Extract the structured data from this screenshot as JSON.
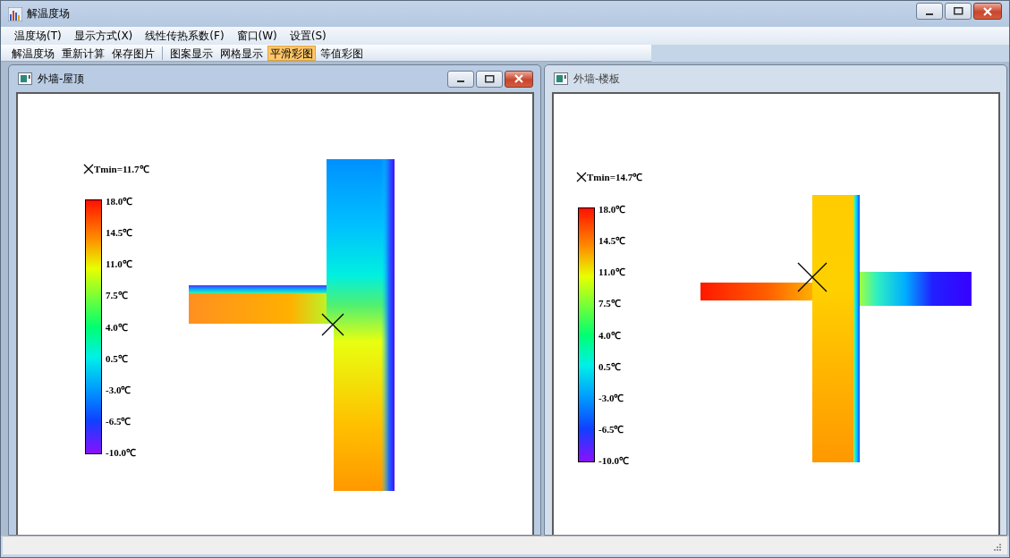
{
  "window": {
    "title": "解温度场"
  },
  "menu": [
    {
      "label": "温度场(T)"
    },
    {
      "label": "显示方式(X)"
    },
    {
      "label": "线性传热系数(F)"
    },
    {
      "label": "窗口(W)"
    },
    {
      "label": "设置(S)"
    }
  ],
  "toolbar": [
    {
      "label": "解温度场",
      "selected": false,
      "separator_before": false
    },
    {
      "label": "重新计算",
      "selected": false,
      "separator_before": false
    },
    {
      "label": "保存图片",
      "selected": false,
      "separator_before": false
    },
    {
      "label": "图案显示",
      "selected": false,
      "separator_before": true
    },
    {
      "label": "网格显示",
      "selected": false,
      "separator_before": false
    },
    {
      "label": "平滑彩图",
      "selected": true,
      "separator_before": false
    },
    {
      "label": "等值彩图",
      "selected": false,
      "separator_before": false
    }
  ],
  "documents": [
    {
      "title": "外墙-屋顶",
      "active": true,
      "kind": "tee",
      "tmin": "Tmin=11.7℃",
      "scale": [
        "18.0℃",
        "14.5℃",
        "11.0℃",
        "7.5℃",
        "4.0℃",
        "0.5℃",
        "-3.0℃",
        "-6.5℃",
        "-10.0℃"
      ]
    },
    {
      "title": "外墙-楼板",
      "active": false,
      "kind": "cross",
      "tmin": "Tmin=14.7℃",
      "scale": [
        "18.0℃",
        "14.5℃",
        "11.0℃",
        "7.5℃",
        "4.0℃",
        "0.5℃",
        "-3.0℃",
        "-6.5℃",
        "-10.0℃"
      ]
    }
  ]
}
